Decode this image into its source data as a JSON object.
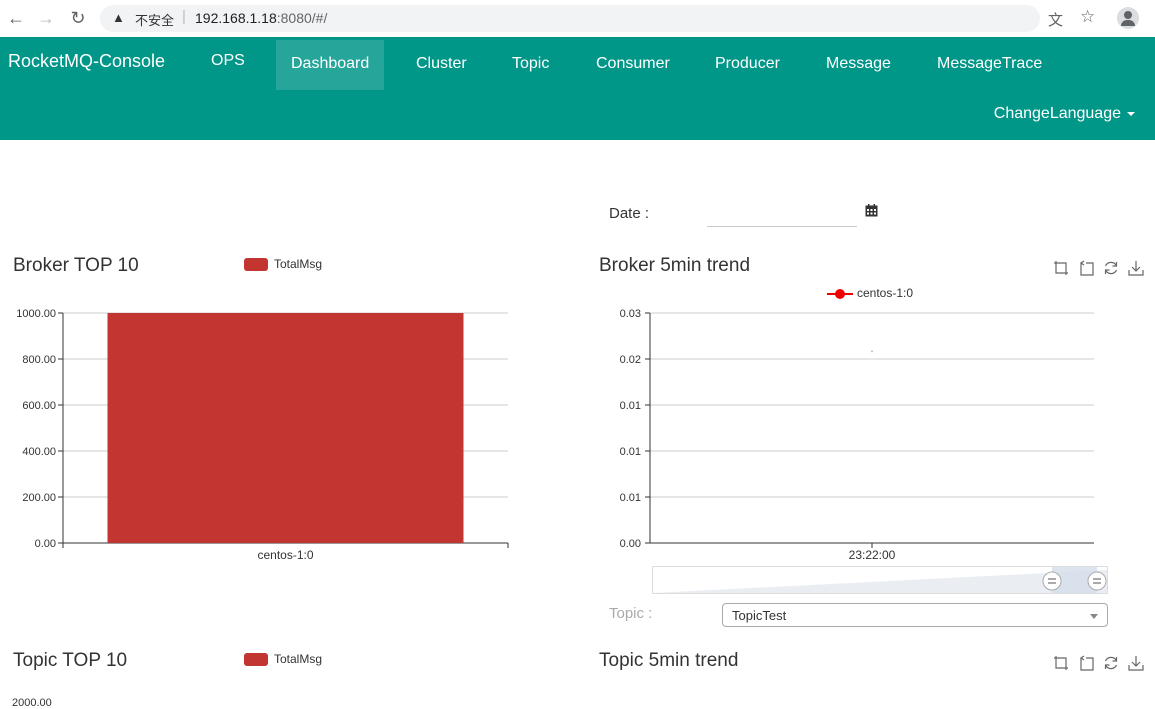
{
  "browser": {
    "insecure_label": "不安全",
    "url_host": "192.168.1.18",
    "url_rest": ":8080/#/"
  },
  "navbar": {
    "brand": "RocketMQ-Console",
    "items": [
      {
        "label": "OPS"
      },
      {
        "label": "Dashboard",
        "active": true
      },
      {
        "label": "Cluster"
      },
      {
        "label": "Topic"
      },
      {
        "label": "Consumer"
      },
      {
        "label": "Producer"
      },
      {
        "label": "Message"
      },
      {
        "label": "MessageTrace"
      }
    ],
    "change_language": "ChangeLanguage",
    "color": "#009688"
  },
  "date_filter": {
    "label": "Date :",
    "value": ""
  },
  "broker_top10": {
    "title": "Broker TOP 10",
    "legend": "TotalMsg"
  },
  "broker_trend": {
    "title": "Broker 5min trend",
    "legend": "centos-1:0"
  },
  "topic_filter": {
    "label": "Topic :",
    "selected": "TopicTest"
  },
  "topic_top10": {
    "title": "Topic TOP 10",
    "legend": "TotalMsg",
    "first_tick": "2000.00"
  },
  "topic_trend": {
    "title": "Topic 5min trend"
  },
  "toolbox_icons": [
    "zoom-icon",
    "zoom-reset-icon",
    "restore-icon",
    "save-image-icon"
  ],
  "chart_data": [
    {
      "type": "bar",
      "title": "Broker TOP 10",
      "categories": [
        "centos-1:0"
      ],
      "series": [
        {
          "name": "TotalMsg",
          "values": [
            1000
          ],
          "color": "#c23531"
        }
      ],
      "yticks": [
        "0.00",
        "200.00",
        "400.00",
        "600.00",
        "800.00",
        "1000.00"
      ],
      "ylim": [
        0,
        1000
      ],
      "grid": true,
      "legend_position": "top-center"
    },
    {
      "type": "line",
      "title": "Broker 5min trend",
      "x": [
        "23:22:00"
      ],
      "series": [
        {
          "name": "centos-1:0",
          "values": [
            0.025
          ],
          "color": "#e00"
        }
      ],
      "yticks": [
        "0.00",
        "0.01",
        "0.01",
        "0.01",
        "0.02",
        "0.03"
      ],
      "ylim": [
        0,
        0.03
      ],
      "grid": true,
      "legend_position": "top-center"
    }
  ]
}
